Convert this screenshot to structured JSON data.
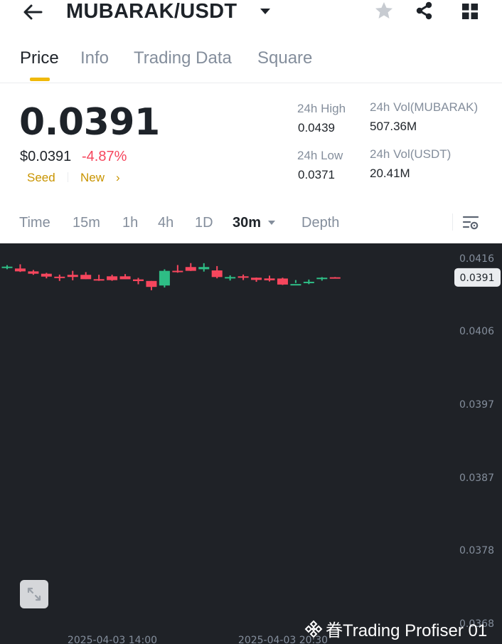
{
  "header": {
    "pair": "MUBARAK/USDT",
    "back_icon": "arrow-left-icon",
    "icons": [
      "star-icon",
      "share-icon",
      "grid-icon"
    ]
  },
  "tabs": [
    {
      "label": "Price",
      "active": true
    },
    {
      "label": "Info"
    },
    {
      "label": "Trading Data"
    },
    {
      "label": "Square"
    }
  ],
  "ticker": {
    "last_price": "0.0391",
    "fiat_price": "$0.0391",
    "change": "-4.87%",
    "tags": [
      "Seed",
      "New"
    ],
    "high_label": "24h High",
    "high_value": "0.0439",
    "low_label": "24h Low",
    "low_value": "0.0371",
    "vol_base_label": "24h Vol(MUBARAK)",
    "vol_base_value": "507.36M",
    "vol_quote_label": "24h Vol(USDT)",
    "vol_quote_value": "20.41M"
  },
  "intervals": {
    "items": [
      "Time",
      "15m",
      "1h",
      "4h",
      "1D",
      "30m",
      "Depth"
    ],
    "active": "30m"
  },
  "chart_data": {
    "type": "candlestick",
    "interval": "30m",
    "y_ticks": [
      "0.0416",
      "0.0406",
      "0.0397",
      "0.0387",
      "0.0378",
      "0.0368"
    ],
    "x_ticks": [
      "2025-04-03 14:00",
      "2025-04-03 20:30"
    ],
    "last_price_label": "0.0391",
    "colors": {
      "up": "#2ebd85",
      "down": "#f6465d",
      "background": "#1f2227"
    },
    "candles": [
      {
        "o": 0.04025,
        "h": 0.04057,
        "l": 0.04002,
        "c": 0.04037
      },
      {
        "o": 0.04012,
        "h": 0.04069,
        "l": 0.03965,
        "c": 0.03973
      },
      {
        "o": 0.03973,
        "h": 0.03992,
        "l": 0.03926,
        "c": 0.03941
      },
      {
        "o": 0.03941,
        "h": 0.03953,
        "l": 0.03878,
        "c": 0.03902
      },
      {
        "o": 0.03901,
        "h": 0.03929,
        "l": 0.03843,
        "c": 0.03891
      },
      {
        "o": 0.03926,
        "h": 0.0398,
        "l": 0.03852,
        "c": 0.03897
      },
      {
        "o": 0.03926,
        "h": 0.03963,
        "l": 0.03868,
        "c": 0.03867
      },
      {
        "o": 0.03867,
        "h": 0.03927,
        "l": 0.03844,
        "c": 0.03856
      },
      {
        "o": 0.03906,
        "h": 0.03927,
        "l": 0.03845,
        "c": 0.03854
      },
      {
        "o": 0.03906,
        "h": 0.03936,
        "l": 0.03869,
        "c": 0.03866
      },
      {
        "o": 0.03864,
        "h": 0.03885,
        "l": 0.03798,
        "c": 0.03841
      },
      {
        "o": 0.03843,
        "h": 0.03843,
        "l": 0.03717,
        "c": 0.03762
      },
      {
        "o": 0.03781,
        "h": 0.04001,
        "l": 0.03754,
        "c": 0.0398
      },
      {
        "o": 0.03981,
        "h": 0.04059,
        "l": 0.03955,
        "c": 0.0398
      },
      {
        "o": 0.04032,
        "h": 0.04085,
        "l": 0.03978,
        "c": 0.0398
      },
      {
        "o": 0.04002,
        "h": 0.04084,
        "l": 0.0397,
        "c": 0.04032
      },
      {
        "o": 0.03986,
        "h": 0.04045,
        "l": 0.03878,
        "c": 0.03896
      },
      {
        "o": 0.03886,
        "h": 0.03919,
        "l": 0.03849,
        "c": 0.03896
      },
      {
        "o": 0.03906,
        "h": 0.0393,
        "l": 0.03855,
        "c": 0.03886
      },
      {
        "o": 0.03887,
        "h": 0.0389,
        "l": 0.03831,
        "c": 0.03857
      },
      {
        "o": 0.03877,
        "h": 0.03915,
        "l": 0.03836,
        "c": 0.03852
      },
      {
        "o": 0.03876,
        "h": 0.03887,
        "l": 0.03788,
        "c": 0.03794
      },
      {
        "o": 0.038,
        "h": 0.03855,
        "l": 0.03815,
        "c": 0.03801
      },
      {
        "o": 0.03832,
        "h": 0.03862,
        "l": 0.03799,
        "c": 0.03832
      },
      {
        "o": 0.03872,
        "h": 0.03895,
        "l": 0.03847,
        "c": 0.03887
      },
      {
        "o": 0.03893,
        "h": 0.03896,
        "l": 0.03884,
        "c": 0.03891
      }
    ]
  },
  "chart_controls": {
    "expand_icon": "expand-icon",
    "settings_icon": "chart-settings-icon"
  },
  "watermark": "眷Trading Profiser 01"
}
